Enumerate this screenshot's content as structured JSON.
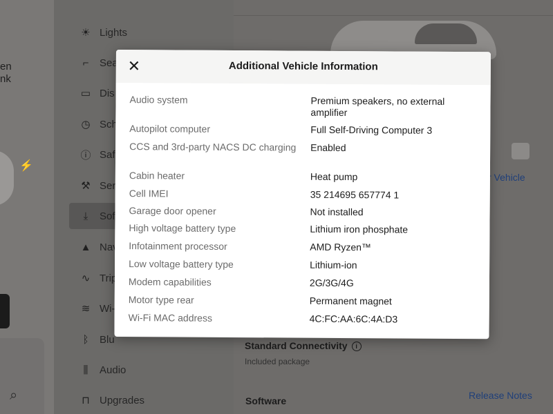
{
  "left_panel": {
    "partial_text_1": "en",
    "partial_text_2": "nk",
    "bolt_icon": "bolt-icon",
    "search_icon": "search-icon"
  },
  "nav": {
    "items": [
      {
        "icon": "lightbulb-icon",
        "glyph": "☀",
        "label": "Lights"
      },
      {
        "icon": "seat-icon",
        "glyph": "⌐",
        "label": "Sea"
      },
      {
        "icon": "display-icon",
        "glyph": "▭",
        "label": "Dis"
      },
      {
        "icon": "clock-icon",
        "glyph": "◷",
        "label": "Sch"
      },
      {
        "icon": "safety-icon",
        "glyph": "ⓘ",
        "label": "Saf"
      },
      {
        "icon": "wrench-icon",
        "glyph": "⚒",
        "label": "Ser"
      },
      {
        "icon": "download-icon",
        "glyph": "⤓",
        "label": "Sof"
      },
      {
        "icon": "navigation-icon",
        "glyph": "▲",
        "label": "Nav"
      },
      {
        "icon": "trips-icon",
        "glyph": "∿",
        "label": "Trip"
      },
      {
        "icon": "wifi-icon",
        "glyph": "≋",
        "label": "Wi-"
      },
      {
        "icon": "bluetooth-icon",
        "glyph": "ᛒ",
        "label": "Blu"
      },
      {
        "icon": "audio-icon",
        "glyph": "⫼",
        "label": "Audio"
      },
      {
        "icon": "lock-icon",
        "glyph": "⊓",
        "label": "Upgrades"
      }
    ]
  },
  "background_content": {
    "link_vehicle": "r Vehicle",
    "standard_connectivity": "Standard Connectivity",
    "included_package": "Included package",
    "software": "Software",
    "release_notes": "Release Notes"
  },
  "modal": {
    "title": "Additional Vehicle Information",
    "close_icon": "close-icon",
    "rows": [
      {
        "label": "Audio system",
        "value": "Premium speakers, no external amplifier"
      },
      {
        "label": "Autopilot computer",
        "value": "Full Self-Driving Computer 3"
      },
      {
        "label": "CCS and 3rd-party NACS DC charging",
        "value": "Enabled"
      },
      {
        "label": "Cabin heater",
        "value": "Heat pump"
      },
      {
        "label": "Cell IMEI",
        "value": "35 214695 657774 1"
      },
      {
        "label": "Garage door opener",
        "value": "Not installed"
      },
      {
        "label": "High voltage battery type",
        "value": "Lithium iron phosphate"
      },
      {
        "label": "Infotainment processor",
        "value": "AMD Ryzen™"
      },
      {
        "label": "Low voltage battery type",
        "value": "Lithium-ion"
      },
      {
        "label": "Modem capabilities",
        "value": "2G/3G/4G"
      },
      {
        "label": "Motor type rear",
        "value": "Permanent magnet"
      },
      {
        "label": "Wi-Fi MAC address",
        "value": "4C:FC:AA:6C:4A:D3"
      }
    ]
  },
  "colors": {
    "modal_bg": "#ffffff",
    "dim_overlay": "#6e6c6a",
    "label_gray": "#6b6b6b",
    "value_dark": "#1c1c1c",
    "link_blue": "#1f3f7a"
  }
}
